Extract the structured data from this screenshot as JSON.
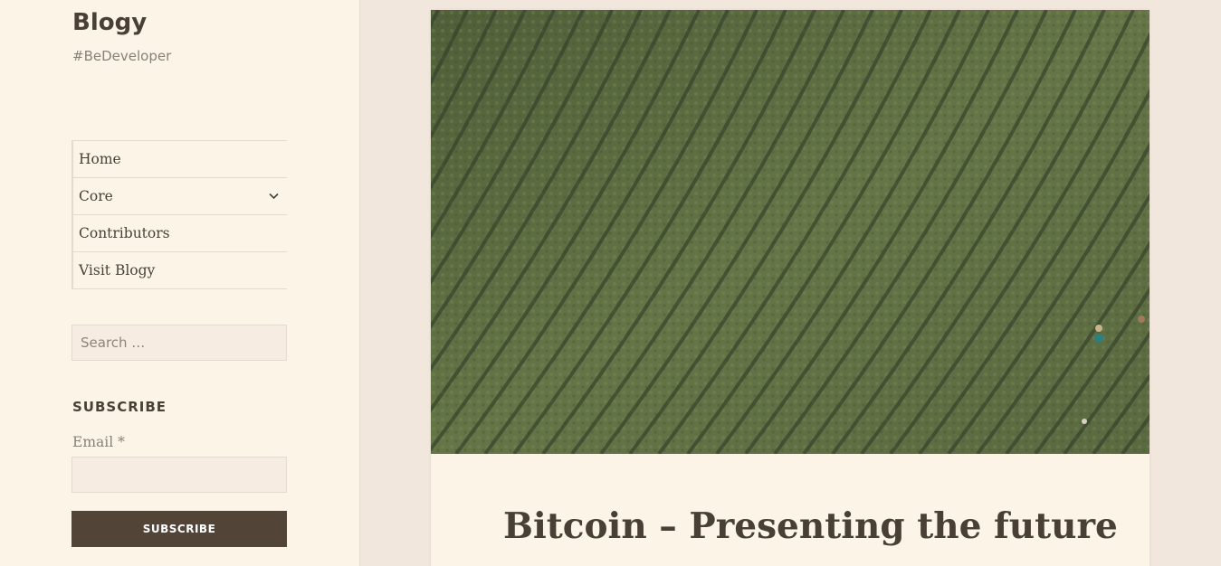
{
  "site": {
    "title": "Blogy",
    "description": "#BeDeveloper"
  },
  "nav": {
    "items": [
      {
        "label": "Home"
      },
      {
        "label": "Core"
      },
      {
        "label": "Contributors"
      },
      {
        "label": "Visit Blogy"
      }
    ]
  },
  "search": {
    "placeholder": "Search …"
  },
  "subscribe": {
    "heading": "SUBSCRIBE",
    "email_label": "Email *",
    "button_label": "SUBSCRIBE"
  },
  "post": {
    "title": "Bitcoin – Presenting the future"
  },
  "colors": {
    "sidebar_bg": "#fdf4e8",
    "page_bg": "#f1e7dc",
    "text": "#4a3f34",
    "button_bg": "#524538"
  }
}
